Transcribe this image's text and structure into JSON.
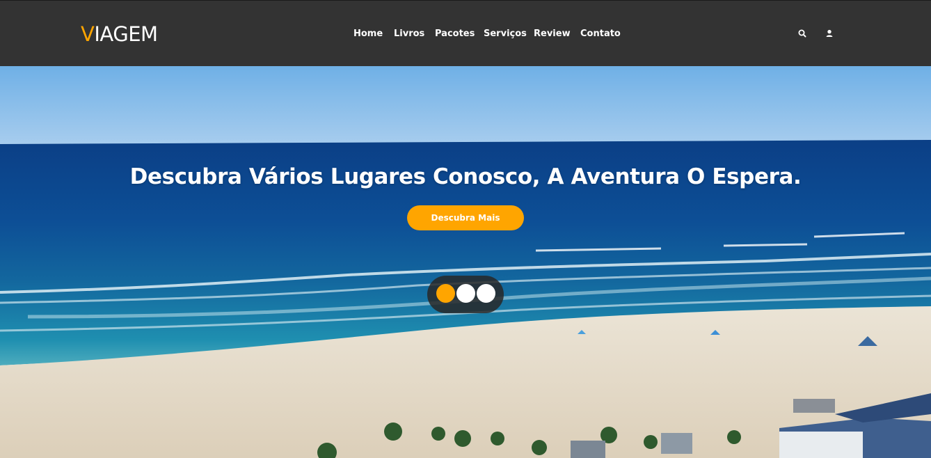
{
  "brand": {
    "first_letter": "V",
    "rest": "IAGEM"
  },
  "nav": {
    "items": [
      "Home",
      "Livros",
      "Pacotes",
      "Serviços",
      "Review",
      "Contato"
    ]
  },
  "icons": {
    "search": "search-icon",
    "user": "user-icon"
  },
  "hero": {
    "title": "Descubra Vários Lugares Conosco, A Aventura O Espera.",
    "cta_label": "Descubra Mais",
    "slides": 3,
    "active_slide": 1
  },
  "colors": {
    "accent": "#ffa500",
    "header_bg": "#333333",
    "text_light": "#ffffff"
  }
}
